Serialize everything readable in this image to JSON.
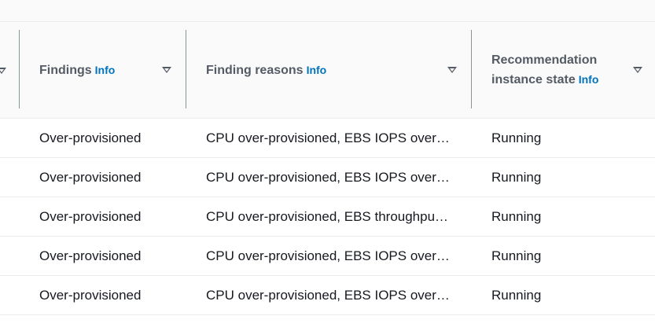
{
  "table": {
    "columns": [
      {
        "label": "Findings",
        "info": "Info"
      },
      {
        "label": "Finding reasons",
        "info": "Info"
      },
      {
        "label_line1": "Recommendation",
        "label_line2": "instance state",
        "info": "Info"
      }
    ],
    "rows": [
      {
        "finding": "Over-provisioned",
        "reasons": "CPU over-provisioned, EBS IOPS over-provisioned",
        "state": "Running"
      },
      {
        "finding": "Over-provisioned",
        "reasons": "CPU over-provisioned, EBS IOPS over-provisioned",
        "state": "Running"
      },
      {
        "finding": "Over-provisioned",
        "reasons": "CPU over-provisioned, EBS throughput over-provisioned",
        "state": "Running"
      },
      {
        "finding": "Over-provisioned",
        "reasons": "CPU over-provisioned, EBS IOPS over-provisioned",
        "state": "Running"
      },
      {
        "finding": "Over-provisioned",
        "reasons": "CPU over-provisioned, EBS IOPS over-provisioned",
        "state": "Running"
      }
    ]
  },
  "colors": {
    "header_text": "#545b64",
    "info_link": "#0073bb",
    "border": "#eaeded"
  },
  "icons": {
    "sort": "caret-down-icon"
  }
}
